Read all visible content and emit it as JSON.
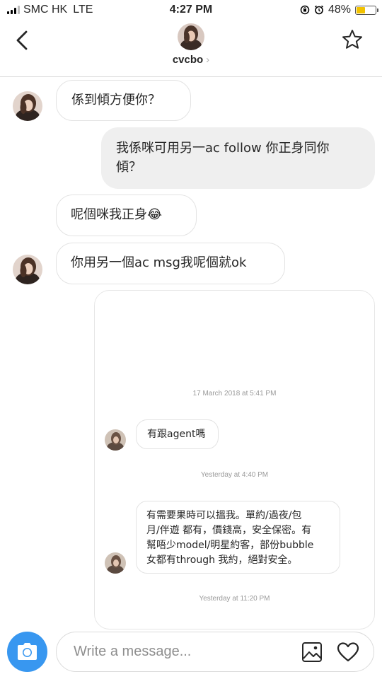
{
  "status": {
    "carrier": "SMC HK",
    "network": "LTE",
    "time": "4:27 PM",
    "battery": "48%",
    "battery_level": 0.48,
    "signal_bars": 3,
    "signal_total": 4
  },
  "header": {
    "username": "cvcbo",
    "chevron": "›"
  },
  "messages": [
    {
      "text": "係到傾方便你？"
    },
    {
      "text_line1": "我係咪可用另一ac follow 你正身同你",
      "text_line2": "傾？"
    },
    {
      "text": "呢個咪我正身😂"
    },
    {
      "text": "你用另一個ac msg我呢個就ok"
    }
  ],
  "shared_post": {
    "timestamp1": "17 March 2018 at 5:41 PM",
    "msg1": "有跟agent嗎",
    "timestamp2": "Yesterday at 4:40 PM",
    "msg2_lines": [
      "有需要果時可以搵我。單約/過夜/包",
      "月/伴遊 都有，價錢高，安全保密。有",
      "幫唔少model/明星約客，部份bubble",
      "女都有through 我約，絕對安全。"
    ],
    "timestamp3": "Yesterday at 11:20 PM"
  },
  "composer": {
    "placeholder": "Write a message..."
  },
  "icons": {
    "back": "chevron-left-icon",
    "favorite": "star-icon",
    "camera": "camera-icon",
    "gallery": "gallery-icon",
    "like": "heart-icon"
  },
  "colors": {
    "camera_button": "#3897f0",
    "outgoing_bubble": "#efefef",
    "battery_fill": "#f2c200"
  }
}
